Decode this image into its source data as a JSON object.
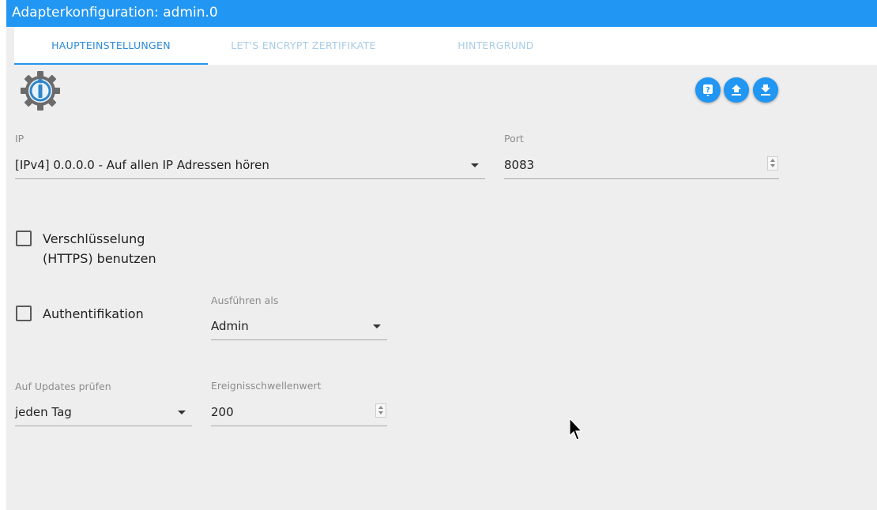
{
  "window": {
    "title": "Adapterkonfiguration: admin.0"
  },
  "tabs": [
    {
      "label": "HAUPTEINSTELLUNGEN",
      "active": true
    },
    {
      "label": "LET'S ENCRYPT ZERTIFIKATE",
      "active": false
    },
    {
      "label": "HINTERGRUND",
      "active": false
    }
  ],
  "toolbar": {
    "buttons": [
      {
        "icon": "help-icon"
      },
      {
        "icon": "upload-icon"
      },
      {
        "icon": "download-icon"
      }
    ]
  },
  "form": {
    "ip": {
      "label": "IP",
      "value": "[IPv4] 0.0.0.0 - Auf allen IP Adressen hören"
    },
    "port": {
      "label": "Port",
      "value": "8083"
    },
    "https": {
      "label_line1": "Verschlüsselung",
      "label_line2": "(HTTPS) benutzen",
      "checked": false
    },
    "auth": {
      "label": "Authentifikation",
      "checked": false
    },
    "run_as": {
      "label": "Ausführen als",
      "value": "Admin"
    },
    "updates": {
      "label": "Auf Updates prüfen",
      "value": "jeden Tag"
    },
    "threshold": {
      "label": "Ereignisschwellenwert",
      "value": "200"
    }
  },
  "colors": {
    "accent": "#2196f3",
    "background": "#eeeeee",
    "tab_inactive": "#a8cce8"
  }
}
